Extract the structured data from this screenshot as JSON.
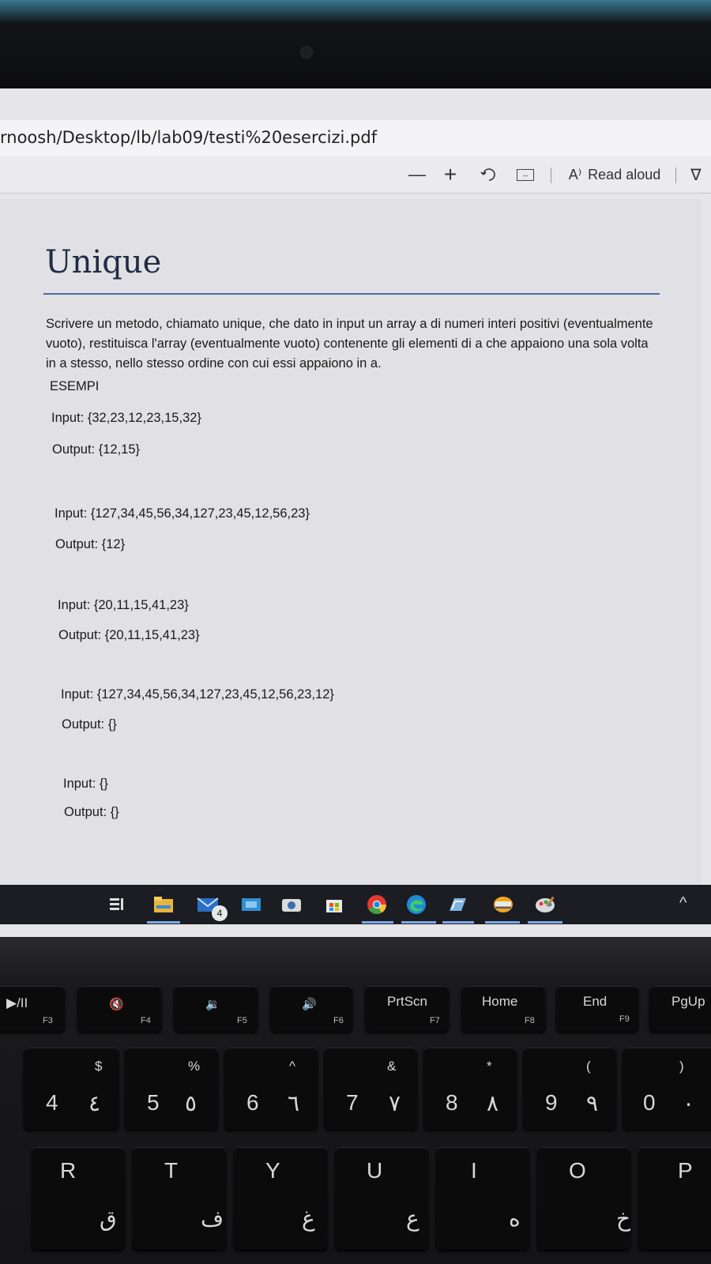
{
  "browser": {
    "url": "rnoosh/Desktop/lb/lab09/testi%20esercizi.pdf",
    "toolbar": {
      "zoom_out": "—",
      "zoom_in": "+",
      "read_aloud_label": "Read aloud"
    }
  },
  "document": {
    "title": "Unique",
    "description_lines": [
      "Scrivere un metodo, chiamato unique, che dato in input un array a di numeri interi positivi (eventualmente",
      "vuoto), restituisca l'array (eventualmente vuoto) contenente gli elementi di a che appaiono una sola volta",
      "in a stesso, nello stesso ordine con cui essi appaiono in a."
    ],
    "examples_heading": "ESEMPI",
    "examples": [
      {
        "input": "Input: {32,23,12,23,15,32}",
        "output": "Output: {12,15}"
      },
      {
        "input": "Input: {127,34,45,56,34,127,23,45,12,56,23}",
        "output": "Output: {12}"
      },
      {
        "input": "Input: {20,11,15,41,23}",
        "output": "Output: {20,11,15,41,23}"
      },
      {
        "input": "Input: {127,34,45,56,34,127,23,45,12,56,23,12}",
        "output": "Output: {}"
      },
      {
        "input": "Input: {}",
        "output": "Output: {}"
      }
    ]
  },
  "taskbar": {
    "mail_badge": "4",
    "icons": [
      "task-view-icon",
      "file-explorer-icon",
      "mail-icon",
      "app-icon",
      "camera-icon",
      "store-icon",
      "chrome-icon",
      "edge-icon",
      "notes-icon",
      "app2-icon",
      "paint-icon"
    ],
    "chevron": "^"
  },
  "keyboard": {
    "fn_row": [
      {
        "main": "▶/II",
        "sub": "F3"
      },
      {
        "main": "🔇",
        "sub": "F4"
      },
      {
        "main": "🔉",
        "sub": "F5"
      },
      {
        "main": "🔊",
        "sub": "F6"
      },
      {
        "main": "PrtScn",
        "sub": "F7"
      },
      {
        "main": "Home",
        "sub": "F8"
      },
      {
        "main": "End",
        "sub": "F9"
      },
      {
        "main": "PgUp",
        "sub": ""
      }
    ],
    "num_row": [
      {
        "main": "4",
        "top": "$",
        "alt": "٤"
      },
      {
        "main": "5",
        "top": "%",
        "alt": "٥"
      },
      {
        "main": "6",
        "top": "^",
        "alt": "٦"
      },
      {
        "main": "7",
        "top": "&",
        "alt": "٧"
      },
      {
        "main": "8",
        "top": "*",
        "alt": "٨"
      },
      {
        "main": "9",
        "top": "(",
        "alt": "٩"
      },
      {
        "main": "0",
        "top": ")",
        "alt": "٠"
      }
    ],
    "letter_row": [
      {
        "main": "R",
        "alt": "ق"
      },
      {
        "main": "T",
        "alt": "ف"
      },
      {
        "main": "Y",
        "alt": "غ"
      },
      {
        "main": "U",
        "alt": "ع"
      },
      {
        "main": "I",
        "alt": "ه"
      },
      {
        "main": "O",
        "alt": "خ"
      },
      {
        "main": "P",
        "alt": ""
      }
    ]
  }
}
